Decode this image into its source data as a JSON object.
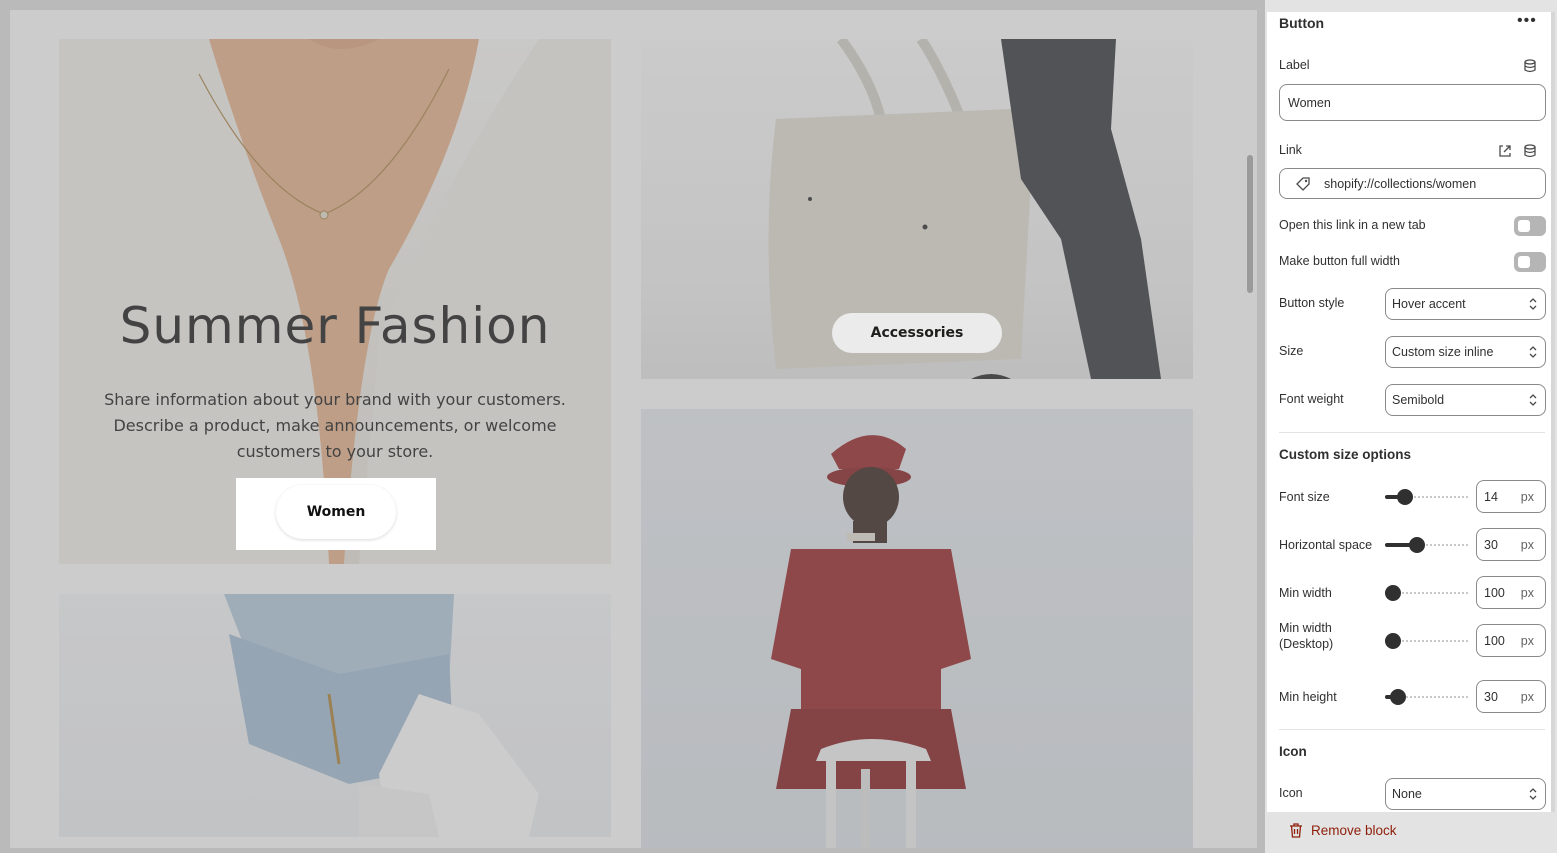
{
  "preview": {
    "hero_title": "Summer Fashion",
    "hero_text": "Share information about your brand with your customers. Describe a product, make announcements, or welcome customers to your store.",
    "hero_button": "Women",
    "accessories_button": "Accessories"
  },
  "panel": {
    "title": "Button",
    "menu_icon": "more-horizontal-icon",
    "label": {
      "label": "Label",
      "value": "Women"
    },
    "link": {
      "label": "Link",
      "value": "shopify://collections/women"
    },
    "open_new_tab": {
      "label": "Open this link in a new tab",
      "on": false
    },
    "full_width": {
      "label": "Make button full width",
      "on": false
    },
    "button_style": {
      "label": "Button style",
      "value": "Hover accent"
    },
    "size": {
      "label": "Size",
      "value": "Custom size inline"
    },
    "font_weight": {
      "label": "Font weight",
      "value": "Semibold"
    },
    "custom_size_heading": "Custom size options",
    "sliders": [
      {
        "label": "Font size",
        "value": "14",
        "unit": "px",
        "level": 0.17
      },
      {
        "label": "Horizontal space",
        "value": "30",
        "unit": "px",
        "level": 0.36
      },
      {
        "label": "Min width",
        "value": "100",
        "unit": "px",
        "level": 0.0
      },
      {
        "label": "Min width",
        "label2": "(Desktop)",
        "value": "100",
        "unit": "px",
        "level": 0.0
      },
      {
        "label": "Min height",
        "value": "30",
        "unit": "px",
        "level": 0.07
      }
    ],
    "icon_heading": "Icon",
    "icon": {
      "label": "Icon",
      "value": "None"
    },
    "remove_block": "Remove block"
  },
  "colors": {
    "danger": "#8e1f0b",
    "text": "#303030",
    "overlay": "#787878"
  }
}
